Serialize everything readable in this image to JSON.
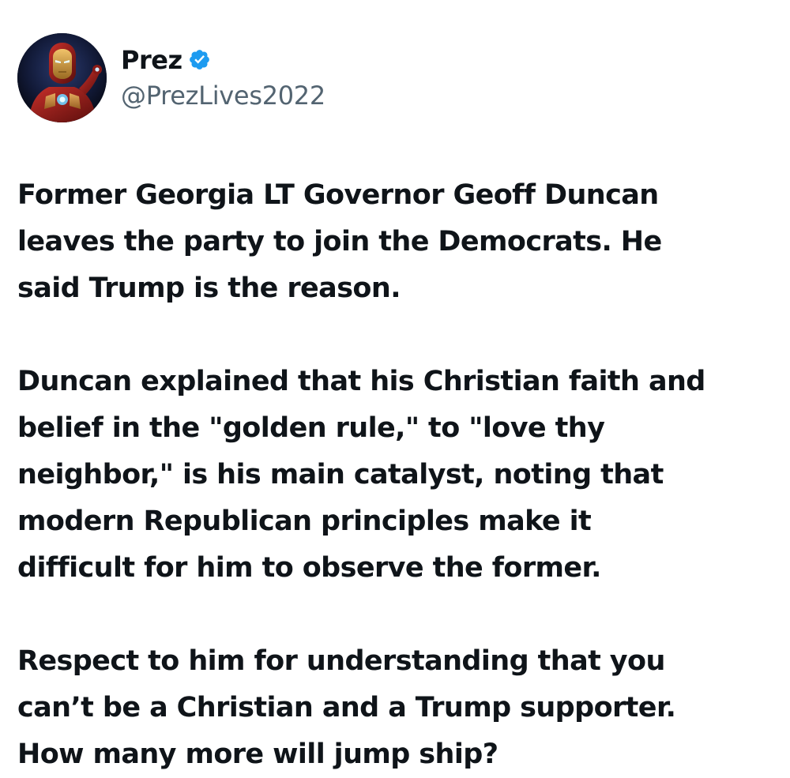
{
  "tweet": {
    "author": {
      "display_name": "Prez",
      "handle": "@PrezLives2022",
      "verified": true,
      "verified_badge_icon": "verified-check-icon",
      "avatar_icon": "iron-man-avatar"
    },
    "paragraphs": [
      {
        "lines": [
          "Former Georgia LT Governor Geoff Duncan",
          "leaves the party to join the Democrats. He",
          "said Trump is the reason."
        ]
      },
      {
        "lines": [
          "Duncan explained that his Christian faith and",
          "belief in the \"golden rule,\" to \"love thy",
          "neighbor,\" is his main catalyst, noting that",
          "modern Republican principles make it",
          "difficult for him to observe the former."
        ]
      },
      {
        "lines": [
          "Respect to him for understanding that you",
          "can’t be a Christian and a Trump supporter.",
          "How many more will jump ship?"
        ]
      }
    ]
  },
  "colors": {
    "text": "#0f1419",
    "handle": "#536471",
    "verified_badge": "#1d9bf0",
    "background": "#ffffff"
  }
}
